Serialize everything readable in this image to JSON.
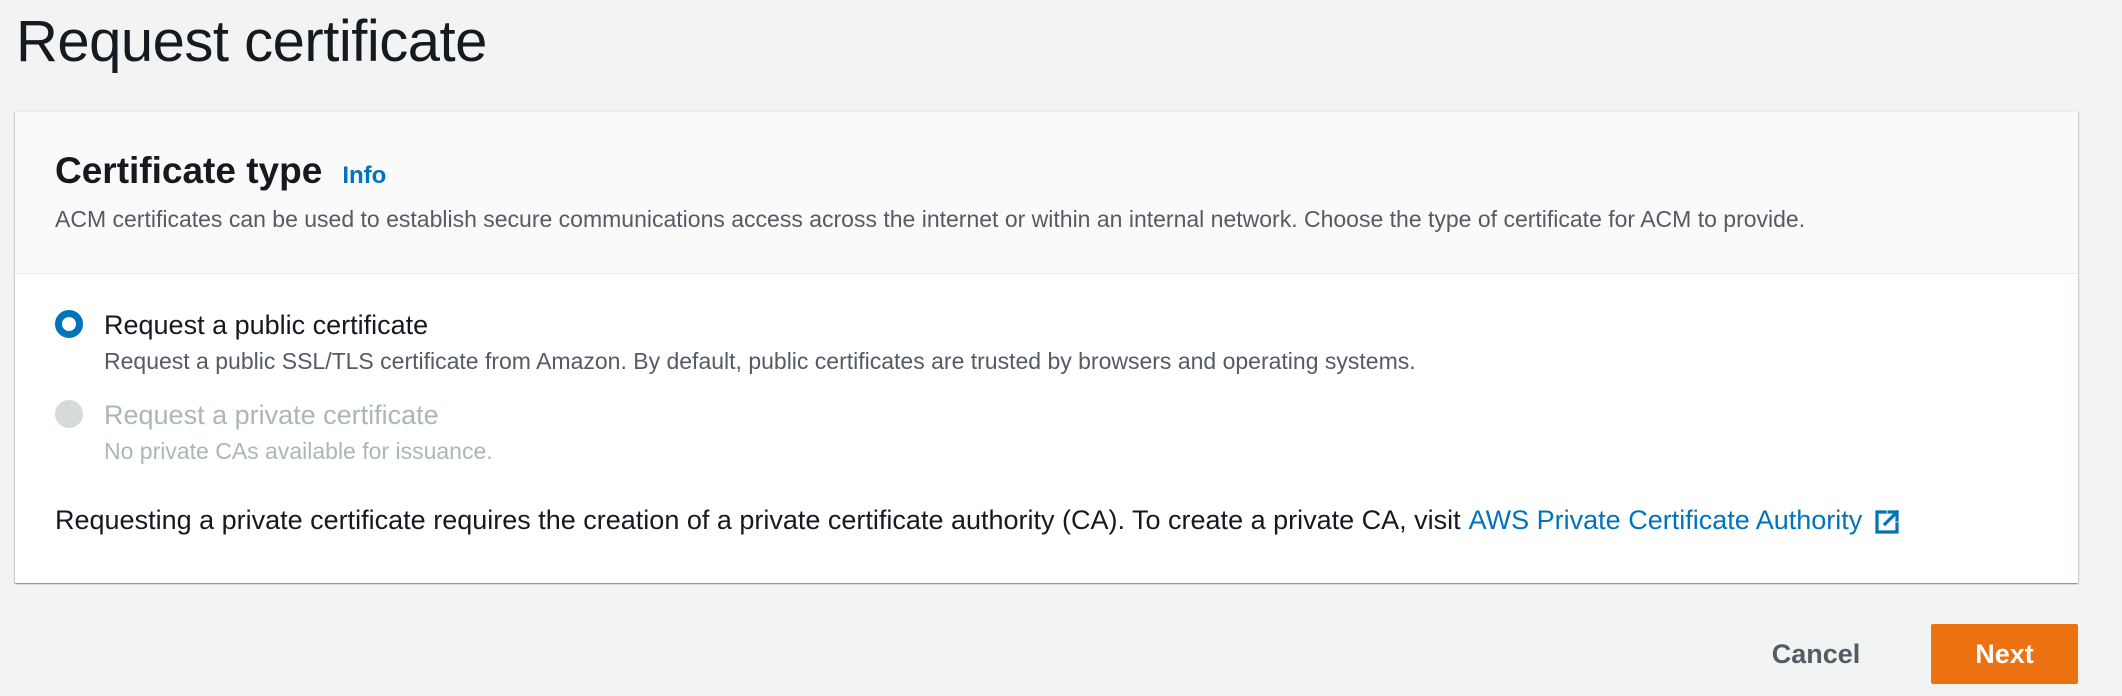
{
  "page": {
    "title": "Request certificate"
  },
  "certificate_type": {
    "heading": "Certificate type",
    "info_label": "Info",
    "description": "ACM certificates can be used to establish secure communications access across the internet or within an internal network. Choose the type of certificate for ACM to provide.",
    "options": [
      {
        "label": "Request a public certificate",
        "description": "Request a public SSL/TLS certificate from Amazon. By default, public certificates are trusted by browsers and operating systems.",
        "selected": true,
        "disabled": false
      },
      {
        "label": "Request a private certificate",
        "description": "No private CAs available for issuance.",
        "selected": false,
        "disabled": true
      }
    ],
    "note_text": "Requesting a private certificate requires the creation of a private certificate authority (CA). To create a private CA, visit",
    "note_link": "AWS Private Certificate Authority"
  },
  "footer": {
    "cancel_label": "Cancel",
    "next_label": "Next"
  },
  "colors": {
    "accent": "#0073bb",
    "primary_button": "#ec7211",
    "background": "#f2f3f3"
  },
  "icons": {
    "external_link": "external-link-icon"
  }
}
